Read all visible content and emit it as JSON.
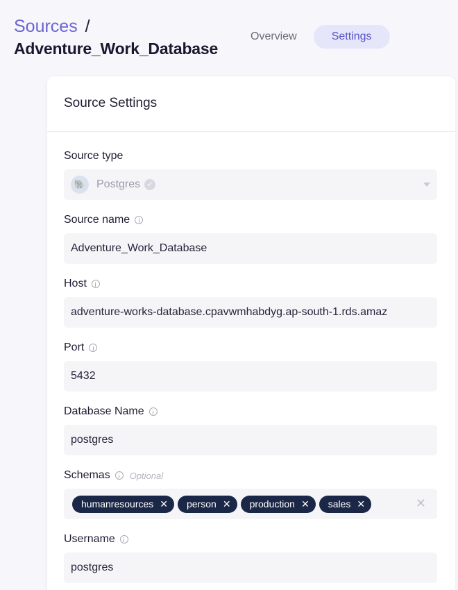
{
  "breadcrumb": {
    "parent": "Sources",
    "separator": "/"
  },
  "page_title": "Adventure_Work_Database",
  "tabs": [
    {
      "label": "Overview",
      "active": false
    },
    {
      "label": "Settings",
      "active": true
    }
  ],
  "card": {
    "title": "Source Settings",
    "fields": {
      "source_type": {
        "label": "Source type",
        "value": "Postgres",
        "icon": "postgres-elephant-icon",
        "disabled": true
      },
      "source_name": {
        "label": "Source name",
        "value": "Adventure_Work_Database"
      },
      "host": {
        "label": "Host",
        "value": "adventure-works-database.cpavwmhabdyg.ap-south-1.rds.amaz"
      },
      "port": {
        "label": "Port",
        "value": "5432"
      },
      "database_name": {
        "label": "Database Name",
        "value": "postgres"
      },
      "schemas": {
        "label": "Schemas",
        "optional": "Optional",
        "tags": [
          "humanresources",
          "person",
          "production",
          "sales"
        ]
      },
      "username": {
        "label": "Username",
        "value": "postgres"
      }
    }
  },
  "colors": {
    "accent": "#6a64d6",
    "tab_active_bg": "#e6e6fa",
    "tag_bg": "#1b2747",
    "input_bg": "#f5f5f8"
  }
}
